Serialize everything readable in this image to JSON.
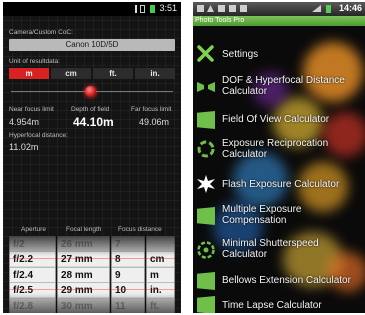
{
  "left_screen": {
    "status_time": "3:51",
    "camera_label": "Camera/Custom CoC:",
    "camera_value": "Canon 10D/5D",
    "units_label": "Unit of resultdata:",
    "units": [
      "m",
      "cm",
      "ft.",
      "in."
    ],
    "selected_unit": "m",
    "near_label": "Near focus limit",
    "dof_label": "Depth of field",
    "far_label": "Far focus limit",
    "near_value": "4.954m",
    "dof_value": "44.10m",
    "far_value": "49.06m",
    "hyperfocal_label": "Hyperfocal distance:",
    "hyperfocal_value": "11.02m",
    "column_headers": [
      "Aperture",
      "Focal length",
      "Focus distance"
    ],
    "aperture_values": [
      "f/2",
      "f/2.2",
      "f/2.4",
      "f/2.5",
      "f/2.8"
    ],
    "focal_values": [
      "26 mm",
      "27 mm",
      "28 mm",
      "29 mm",
      "30 mm"
    ],
    "distance_values": [
      "7",
      "8",
      "9",
      "10",
      "11"
    ],
    "distance_units": [
      "",
      "cm",
      "m",
      "in.",
      "ft."
    ]
  },
  "right_screen": {
    "status_time": "14:46",
    "app_title": "Photo Tools Pro",
    "menu": [
      {
        "label": "Settings",
        "icon": "tools-icon"
      },
      {
        "label": "DOF & Hyperfocal Distance Calculator",
        "icon": "dof-icon"
      },
      {
        "label": "Field Of View Calculator",
        "icon": "fov-icon"
      },
      {
        "label": "Exposure Reciprocation Calculator",
        "icon": "reciprocation-icon"
      },
      {
        "label": "Flash Exposure Calculator",
        "icon": "flash-icon"
      },
      {
        "label": "Multiple Exposure Compensation",
        "icon": "multiple-exposure-icon"
      },
      {
        "label": "Minimal Shutterspeed Calculator",
        "icon": "shutter-icon"
      },
      {
        "label": "Bellows Extension Calculator",
        "icon": "bellows-icon"
      },
      {
        "label": "Time Lapse Calculator",
        "icon": "timelapse-icon"
      }
    ]
  },
  "colors": {
    "unit_selected": "#d82222",
    "app_green": "#5aa83a",
    "wheel_bg": "#d8d8d8"
  }
}
